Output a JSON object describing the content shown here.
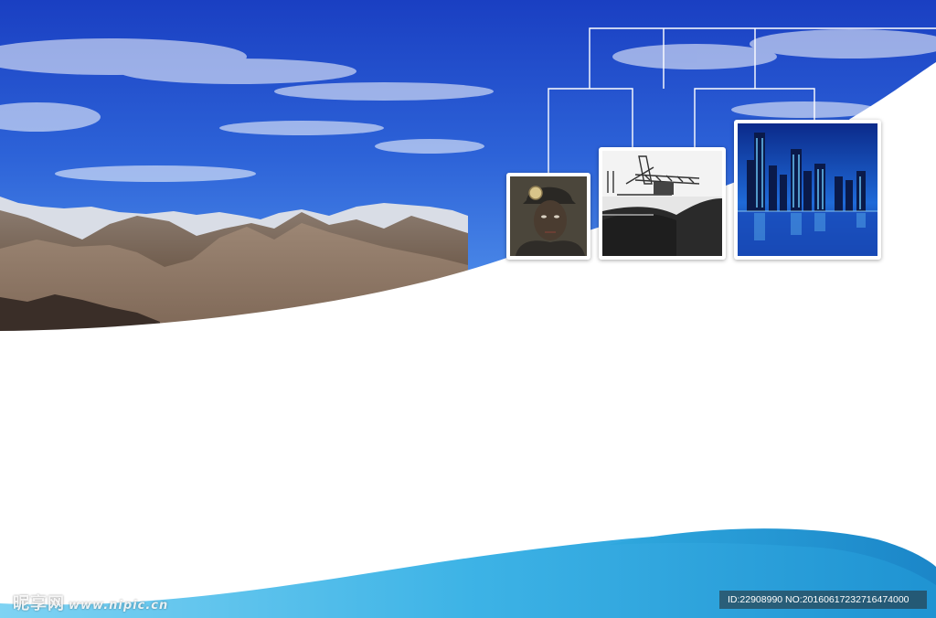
{
  "background": {
    "sky_color": "#1f4fd0",
    "sky_light_color": "#4f8df0",
    "wave_color": "#29a9de",
    "wave_light_color": "#5fc6ee"
  },
  "photos": [
    {
      "subject": "coal miner with headlamp",
      "icon": "miner-photo"
    },
    {
      "subject": "coal loading machinery and coal pile (black and white)",
      "icon": "coal-machinery-photo"
    },
    {
      "subject": "city skyline at night",
      "icon": "city-skyline-photo"
    }
  ],
  "watermark": {
    "brand": "昵享网",
    "site": "www.nipic.cn",
    "id_text": "ID:22908990 NO:20160617232716474000"
  }
}
